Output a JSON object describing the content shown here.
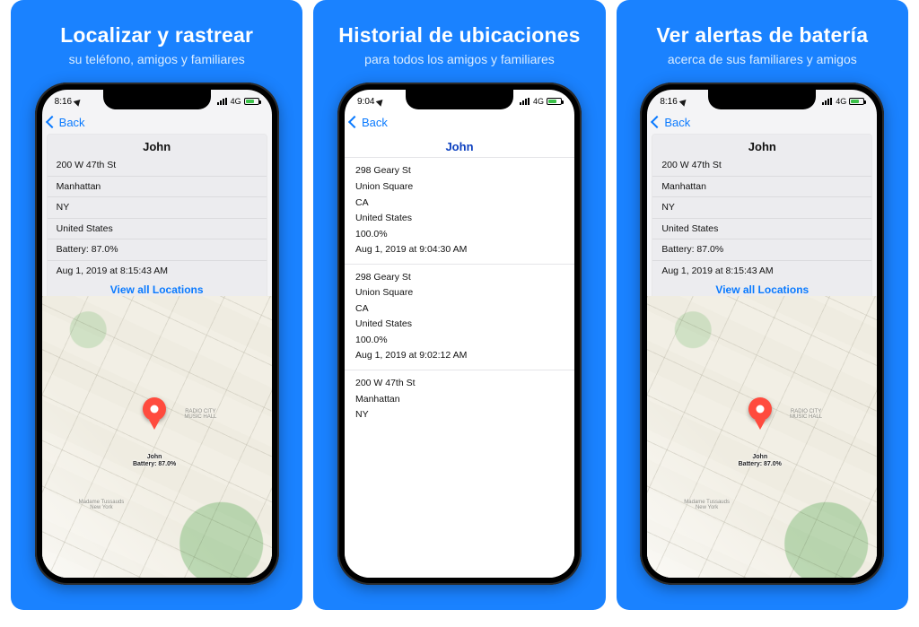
{
  "panels": [
    {
      "title": "Localizar y rastrear",
      "subtitle": "su teléfono, amigos y familiares"
    },
    {
      "title": "Historial de ubicaciones",
      "subtitle": "para todos los amigos y familiares"
    },
    {
      "title": "Ver alertas de batería",
      "subtitle": "acerca de sus familiares y amigos"
    }
  ],
  "status": {
    "time816": "8:16",
    "time904": "9:04",
    "carrier": "4G"
  },
  "nav": {
    "back": "Back"
  },
  "card": {
    "name": "John",
    "street": "200 W 47th St",
    "locality": "Manhattan",
    "region": "NY",
    "country": "United States",
    "battery": "Battery: 87.0%",
    "timestamp": "Aug 1, 2019 at 8:15:43 AM",
    "view_all": "View all Locations"
  },
  "pin": {
    "name": "John",
    "battery": "Battery: 87.0%"
  },
  "history": {
    "name": "John",
    "entries": [
      {
        "street": "298 Geary St",
        "locality": "Union Square",
        "region": "CA",
        "country": "United States",
        "battery": "100.0%",
        "timestamp": "Aug 1, 2019 at 9:04:30 AM"
      },
      {
        "street": "298 Geary St",
        "locality": "Union Square",
        "region": "CA",
        "country": "United States",
        "battery": "100.0%",
        "timestamp": "Aug 1, 2019 at 9:02:12 AM"
      },
      {
        "street": "200 W 47th St",
        "locality": "Manhattan",
        "region": "NY"
      }
    ]
  }
}
